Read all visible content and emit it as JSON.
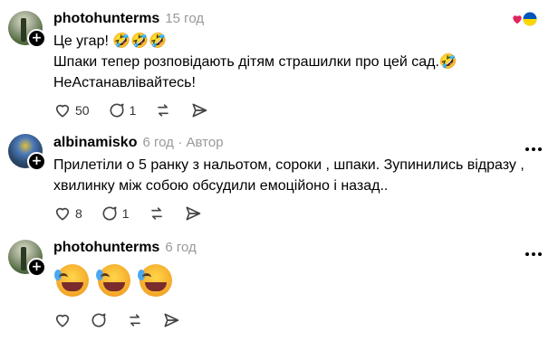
{
  "comments": [
    {
      "username": "photohunterms",
      "time": "15 год",
      "author_tag": "",
      "lines": [
        "Це угар! 🤣🤣🤣",
        "Шпаки тепер розповідають дітям страшилки про цей сад.🤣",
        "НеАстанавлівайтесь!"
      ],
      "likes": "50",
      "replies": "1",
      "reaction_icons": [
        "heart-icon",
        "ukraine-flag-heart-icon"
      ]
    },
    {
      "username": "albinamisko",
      "time": "6 год",
      "author_tag": "· Автор",
      "lines": [
        "Прилетіли о 5 ранку з нальотом, сороки , шпаки. Зупинились відразу ,",
        "хвилинку між собою обсудили емоційоно і назад.."
      ],
      "likes": "8",
      "replies": "1"
    },
    {
      "username": "photohunterms",
      "time": "6 год",
      "author_tag": "",
      "emoji_count": 3,
      "emoji_name": "rolling-on-floor-laughing-emoji",
      "likes": "",
      "replies": ""
    }
  ],
  "colors": {
    "meta_gray": "#999999",
    "text": "#000000",
    "icon": "#444444"
  }
}
